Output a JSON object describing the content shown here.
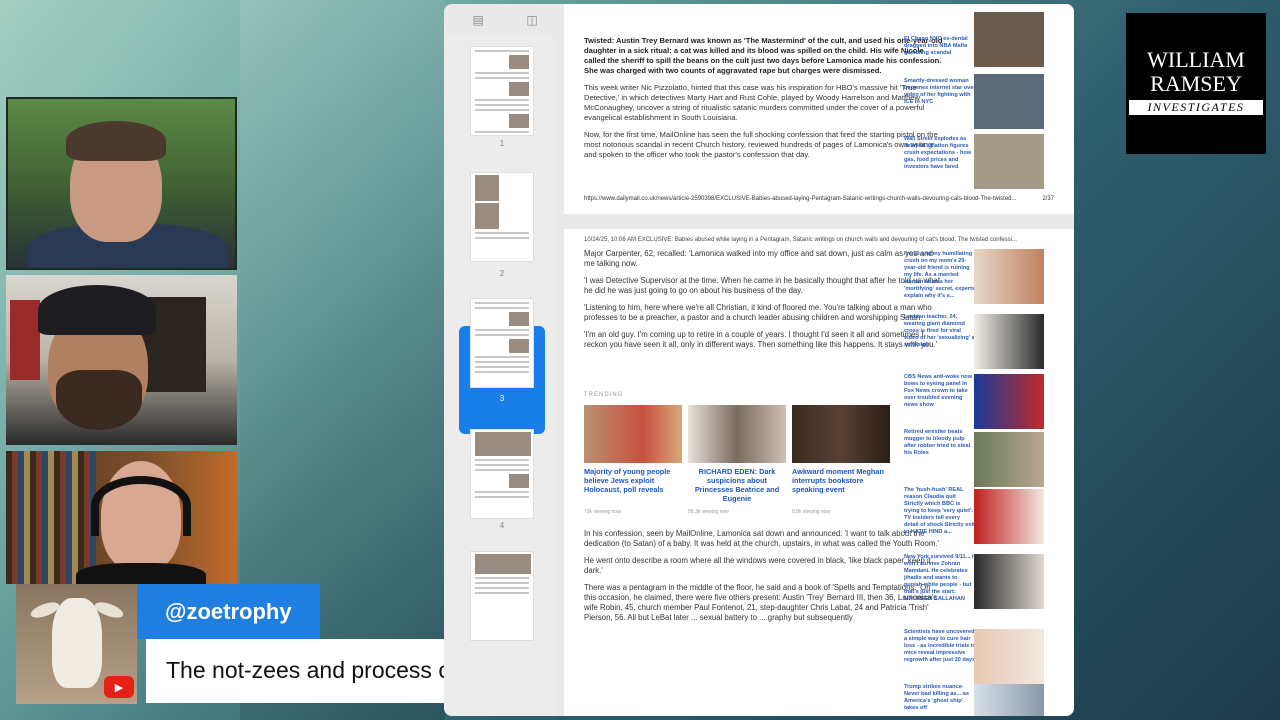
{
  "username": "@zoetrophy",
  "caption": "The not-zees and process church allegedly did similar",
  "logo": {
    "line1": "WILLIAM",
    "line2": "RAMSEY",
    "line3": "INVESTIGATES"
  },
  "pdf": {
    "thumb_numbers": [
      "1",
      "2",
      "3",
      "4"
    ],
    "page1": {
      "p1": "Twisted: Austin Trey Bernard was known as 'The Mastermind' of the cult, and used his one-year-old daughter in a sick ritual: a cat was killed and its blood was spilled on the child. His wife Nicole called the sheriff to spill the beans on the cult just two days before Lamonica made his confession. She was charged with two counts of aggravated rape but charges were dismissed.",
      "p2": "This week writer Nic Pizzolatto, hinted that this case was his inspiration for HBO's massive hit 'True Detective,' in which detectives Marty Hart and Rust Cohle, played by Woody Harrelson and Matthew McConaughey, uncover a string of ritualistic satanic murders committed under the cover of a powerful evangelical establishment in South Louisiana.",
      "p3": "Now, for the first time, MailOnline has seen the full shocking confession that fired the starting pistol on the most notorious scandal in recent Church history, reviewed hundreds of pages of Lamonica's own writing and spoken to the officer who took the pastor's confession that day.",
      "url": "https://www.dailymail.co.uk/news/article-2590398/EXCLUSIVE-Babies-abused-laying-Pentagram-Satanic-writings-church-walls-devouring-cats-blood-The-twisted...",
      "page_count": "2/37",
      "side": [
        "El Chapo NYC ex-dental dragged into NBA Mafia gambling scandal",
        "Smartly-dressed woman becomes internet star over video of her fighting with ICE in NYC",
        "Wall Street explodes as delayed inflation figures crush expectations - how gas, food prices and investors have fared"
      ]
    },
    "page2": {
      "header": "10/24/25, 10:06 AM     EXCLUSIVE: Babies abused while laying in a Pentagram, Satanic writings on church walls and devouring of cat's blood. The twisted confessi...",
      "paras": [
        "Major Carpenter, 62, recalled: 'Lamonica walked into my office and sat down, just as calm as you and me talking now.",
        "'I was Detective Supervisor at the time. When he came in he basically thought that after he told us what he did he was just going to go on about his business of the day.",
        "'Listening to him, here where we're all Christian, it kind of floored me. You're talking about a man who professes to be a preacher, a pastor and a church leader abusing children and worshipping Satan.",
        "'I'm an old guy. I'm coming up to retire in a couple of years. I thought I'd seen it all and sometimes I reckon you have seen it all, only in different ways. Then something like this happens. It stays with you.'"
      ],
      "trending_label": "TRENDING",
      "trending": [
        {
          "caption": "Majority of young people believe Jews exploit Holocaust, poll reveals",
          "meta": "73k viewing now"
        },
        {
          "caption": "RICHARD EDEN: Dark suspicions about Princesses Beatrice and Eugenie",
          "meta": "58.3k viewing now"
        },
        {
          "caption": "Awkward moment Meghan interrupts bookstore speaking event",
          "meta": "8.8k viewing now"
        }
      ],
      "paras2": [
        "In his confession, seen by MailOnline, Lamonica sat down and announced: 'I want to talk about the dedication (to Satan) of a baby. It was held at the church, upstairs, in what was called the Youth Room.'",
        "He went onto describe a room where all the windows were covered in black, 'like black paper, keep it dark.'",
        "There was a pentagram in the middle of the floor, he said and a book of 'Spells and Temptations.' On this occasion, he claimed, there were five others present: Austin 'Trey' Bernard III, then 36, Lamonica's wife Robin, 45, church member Paul Fontenot, 21, step-daughter Chris Labat, 24 and Patricia 'Trish' Pierson, 56. All but LeBat later ... sexual battery to ... graphy but subsequently"
      ],
      "side": [
        "I'm 50 and my humiliating crush on my mom's 20-year-old friend is ruining my life. As a married woman shares her 'mortifying' secret, experts explain why it's s...",
        "Lesbian teacher, 24, wearing giant diamond cross is fired for viral video of her 'sexualizing' a schoolgirl",
        "CBS News anti-woke now bows to eyeing panel in Fox News crown to take over troubled evening news show",
        "Retired wrestler beats mugger to bloody pulp after robber tried to steal his Rolex",
        "The 'hush-hush' REAL reason Claudia quit Strictly which BBC is trying to keep 'very quiet': TV insiders tell every detail of shock Strictly exit to KATIE HIND a...",
        "New York survived 9/11... it won't survive Zohran Mamdani. He celebrates jihadis and wants to punish white people - but that's just the start: MAUREEN CALLAHAN",
        "Scientists have uncovered a simple way to cure hair loss - as incredible trials in mice reveal impressive regrowth after just 20 days",
        "Trump strikes nuance-Never bad killing as... as America's 'ghost ship' takes off"
      ]
    }
  }
}
